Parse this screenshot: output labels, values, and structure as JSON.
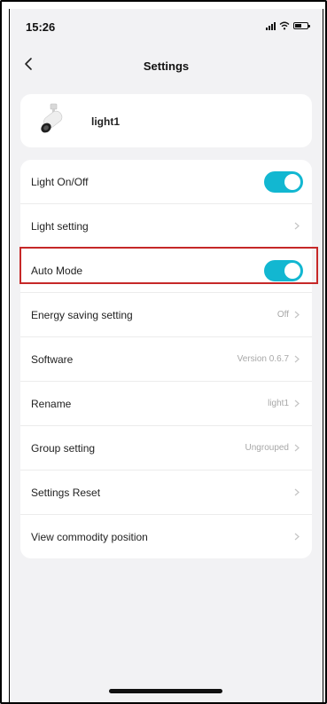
{
  "status_bar": {
    "time": "15:26",
    "battery_icon": "battery-icon",
    "wifi_icon": "wifi-icon",
    "signal_icon": "signal-icon"
  },
  "header": {
    "title": "Settings",
    "back_icon": "chevron-left-icon"
  },
  "device": {
    "name": "light1",
    "icon": "track-light-icon"
  },
  "settings": {
    "light_onoff": {
      "label": "Light On/Off",
      "enabled": true
    },
    "light_setting": {
      "label": "Light setting"
    },
    "auto_mode": {
      "label": "Auto Mode",
      "enabled": true
    },
    "energy_saving": {
      "label": "Energy saving setting",
      "value": "Off"
    },
    "software": {
      "label": "Software",
      "value": "Version 0.6.7"
    },
    "rename": {
      "label": "Rename",
      "value": "light1"
    },
    "group": {
      "label": "Group setting",
      "value": "Ungrouped"
    },
    "reset": {
      "label": "Settings Reset"
    },
    "view_position": {
      "label": "View commodity position"
    }
  },
  "colors": {
    "toggle_on": "#12b7d1",
    "highlight": "#c62828",
    "background": "#f2f2f4"
  }
}
